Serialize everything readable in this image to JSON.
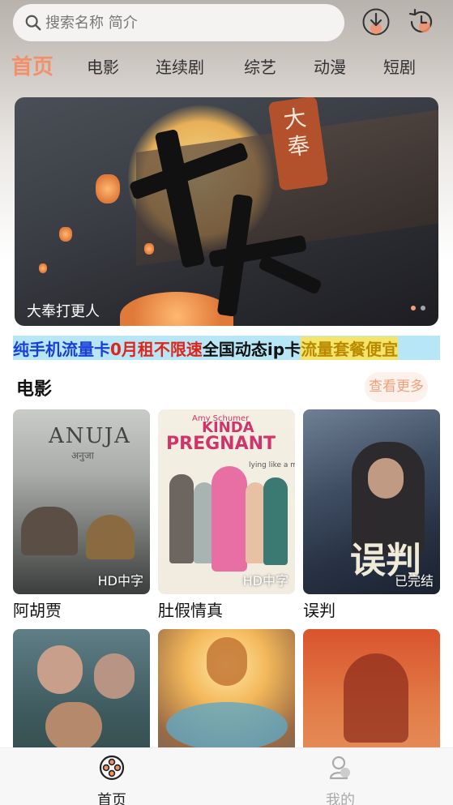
{
  "search": {
    "placeholder": "搜索名称 简介"
  },
  "header_icons": [
    "download-icon",
    "history-icon"
  ],
  "tabs": [
    {
      "label": "首页",
      "active": true
    },
    {
      "label": "电影"
    },
    {
      "label": "连续剧"
    },
    {
      "label": "综艺"
    },
    {
      "label": "动漫"
    },
    {
      "label": "短剧"
    }
  ],
  "banner": {
    "title": "大奉打更人",
    "artwork_text": "打更",
    "seal_text": "大奉",
    "slides": 2,
    "current_slide": 1
  },
  "ad_banner": {
    "segments": [
      {
        "text": "纯手机流量卡",
        "color": "#1a3fd8"
      },
      {
        "text": "0月租不限速",
        "color": "#e0241a"
      },
      {
        "text": "全国动态ip卡",
        "color": "#111111"
      },
      {
        "text": "流量套餐便宜",
        "color": "#b98a00"
      }
    ]
  },
  "section": {
    "title": "电影",
    "more_label": "查看更多",
    "items": [
      {
        "name": "阿胡贾",
        "badge": "HD中字",
        "poster_title": "ANUJA",
        "poster_subtitle": "अनुजा"
      },
      {
        "name": "肚假情真",
        "badge": "HD中字",
        "poster_credit": "Amy Schumer",
        "poster_title_1": "KINDA",
        "poster_title_2": "PREGNANT",
        "poster_tagline": "lying like a mother."
      },
      {
        "name": "误判",
        "badge": "已完结",
        "poster_title": "误判"
      },
      {
        "name": "",
        "badge": ""
      },
      {
        "name": "",
        "badge": ""
      },
      {
        "name": "",
        "badge": ""
      }
    ]
  },
  "bottom_nav": [
    {
      "label": "首页",
      "icon": "film-reel-icon",
      "active": true,
      "color": "#222222"
    },
    {
      "label": "我的",
      "icon": "user-icon",
      "active": false,
      "color": "#aaaaaa"
    }
  ],
  "colors": {
    "accent": "#f2906a",
    "more_bg": "#fdf1eb",
    "ad_bg": "#b7e6f6"
  }
}
